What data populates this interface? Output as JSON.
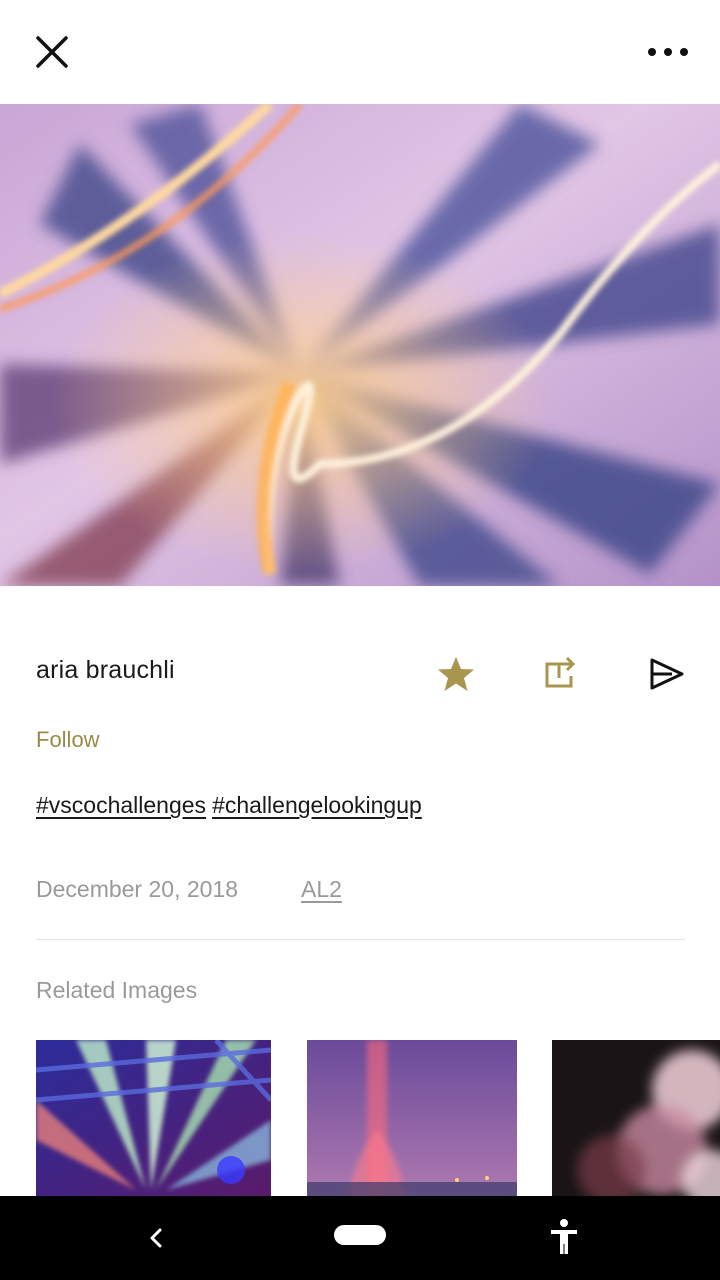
{
  "header": {
    "close_icon": "close-icon",
    "more_icon": "more-horizontal-icon"
  },
  "post": {
    "username": "aria brauchli",
    "follow_label": "Follow",
    "tags": [
      "#vscochallenges",
      "#challengelookingup"
    ],
    "date": "December 20, 2018",
    "preset": "AL2",
    "actions": {
      "favorite_icon": "star-icon",
      "repost_icon": "repost-icon",
      "send_icon": "send-icon"
    }
  },
  "related": {
    "title": "Related Images"
  },
  "system_nav": {
    "back_icon": "back-chevron-icon",
    "home_icon": "home-pill-icon",
    "accessibility_icon": "accessibility-icon"
  },
  "colors": {
    "accent": "#9a8a4a",
    "secondary_text": "#9a9a9a",
    "nav_bar": "#000000"
  }
}
